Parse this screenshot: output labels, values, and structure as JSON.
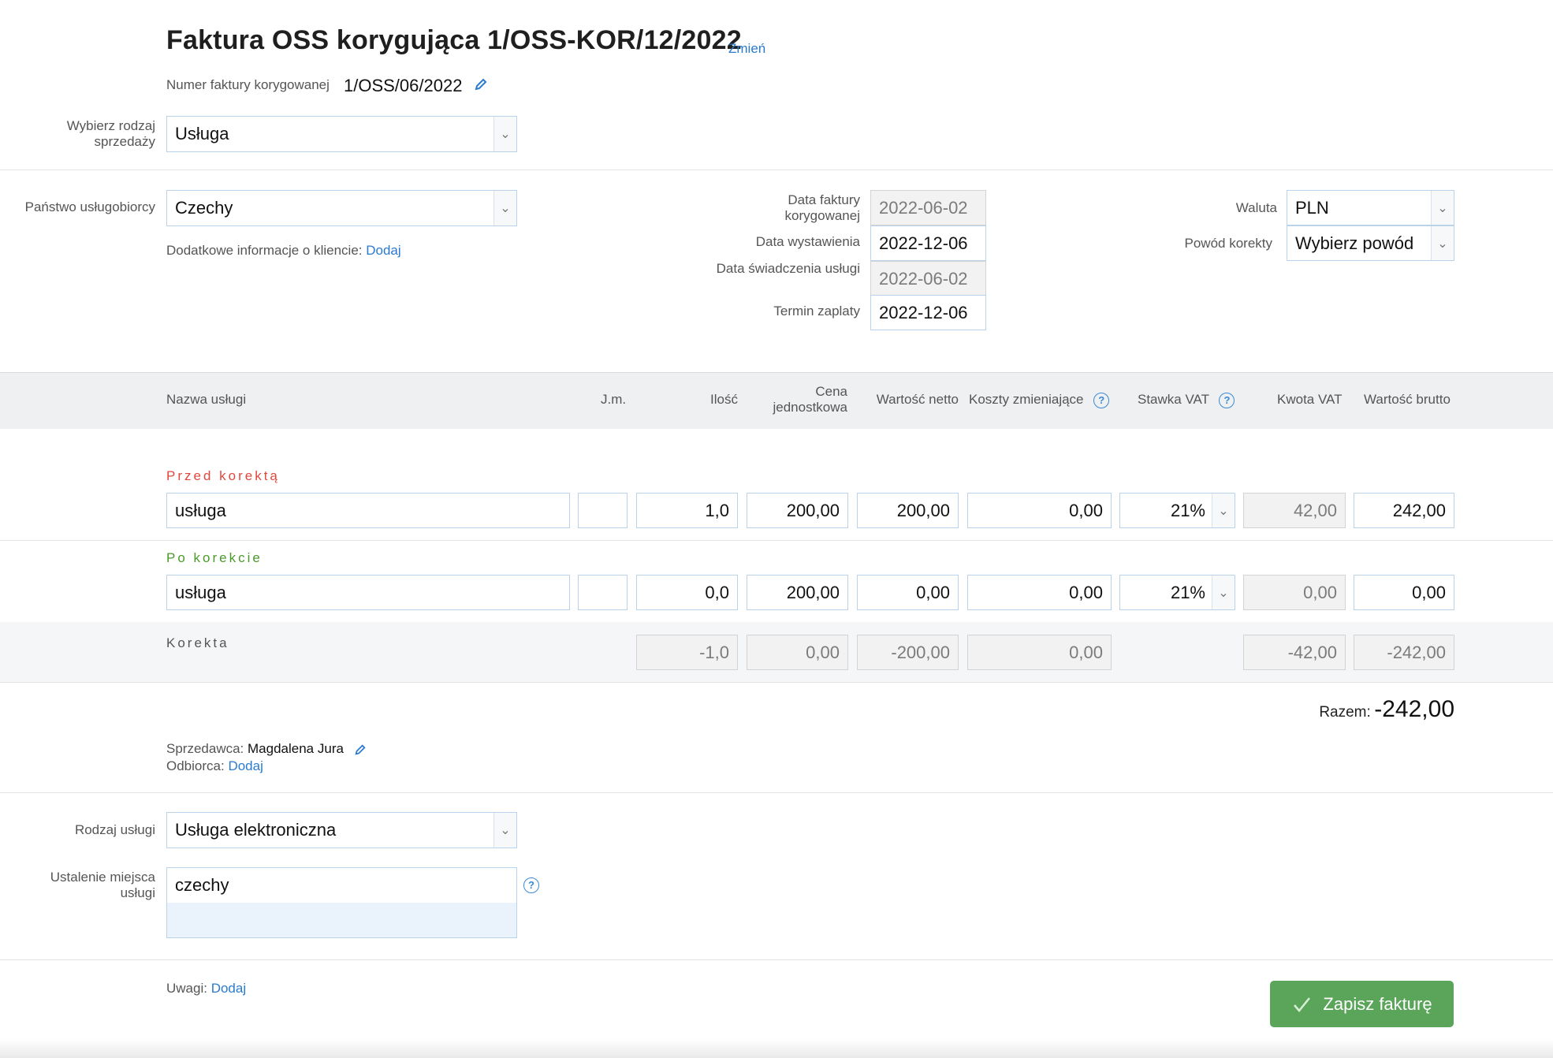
{
  "header": {
    "title": "Faktura OSS korygująca 1/OSS-KOR/12/2022",
    "change_link": "Zmień",
    "corrected_label": "Numer faktury korygowanej",
    "corrected_value": "1/OSS/06/2022"
  },
  "sale_type": {
    "label": "Wybierz rodzaj sprzedaży",
    "value": "Usługa"
  },
  "client": {
    "country_label": "Państwo usługobiorcy",
    "country_value": "Czechy",
    "extra_info_label": "Dodatkowe informacje o kliencie:",
    "extra_info_link": "Dodaj"
  },
  "dates": {
    "corrected_date_label": "Data faktury korygowanej",
    "corrected_date_value": "2022-06-02",
    "issue_date_label": "Data wystawienia",
    "issue_date_value": "2022-12-06",
    "service_date_label": "Data świadczenia usługi",
    "service_date_value": "2022-06-02",
    "payment_term_label": "Termin zaplaty",
    "payment_term_value": "2022-12-06"
  },
  "currency": {
    "label": "Waluta",
    "value": "PLN"
  },
  "reason": {
    "label": "Powód korekty",
    "value": "Wybierz powód"
  },
  "table_headers": {
    "name": "Nazwa usługi",
    "unit": "J.m.",
    "qty": "Ilość",
    "unit_price": "Cena jednostkowa",
    "net": "Wartość netto",
    "costs": "Koszty zmieniające",
    "vat_rate": "Stawka VAT",
    "vat_amount": "Kwota VAT",
    "gross": "Wartość brutto"
  },
  "before": {
    "label": "Przed korektą",
    "name": "usługa",
    "unit": "",
    "qty": "1,0",
    "unit_price": "200,00",
    "net": "200,00",
    "costs": "0,00",
    "vat_rate": "21%",
    "vat_amount": "42,00",
    "gross": "242,00"
  },
  "after": {
    "label": "Po korekcie",
    "name": "usługa",
    "unit": "",
    "qty": "0,0",
    "unit_price": "200,00",
    "net": "0,00",
    "costs": "0,00",
    "vat_rate": "21%",
    "vat_amount": "0,00",
    "gross": "0,00"
  },
  "correction": {
    "label": "Korekta",
    "qty": "-1,0",
    "unit_price": "0,00",
    "net": "-200,00",
    "costs": "0,00",
    "vat_amount": "-42,00",
    "gross": "-242,00"
  },
  "total": {
    "label": "Razem:",
    "value": "-242,00"
  },
  "parties": {
    "seller_label": "Sprzedawca:",
    "seller_value": "Magdalena Jura",
    "buyer_label": "Odbiorca:",
    "buyer_link": "Dodaj"
  },
  "service": {
    "type_label": "Rodzaj usługi",
    "type_value": "Usługa elektroniczna",
    "place_label": "Ustalenie miejsca usługi",
    "place_value": "czechy"
  },
  "notes": {
    "label": "Uwagi:",
    "link": "Dodaj"
  },
  "save_button": "Zapisz fakturę",
  "colors": {
    "before": "#e0483d",
    "after": "#4a9a2a",
    "link": "#2a7bd0",
    "save": "#5aa55a"
  }
}
